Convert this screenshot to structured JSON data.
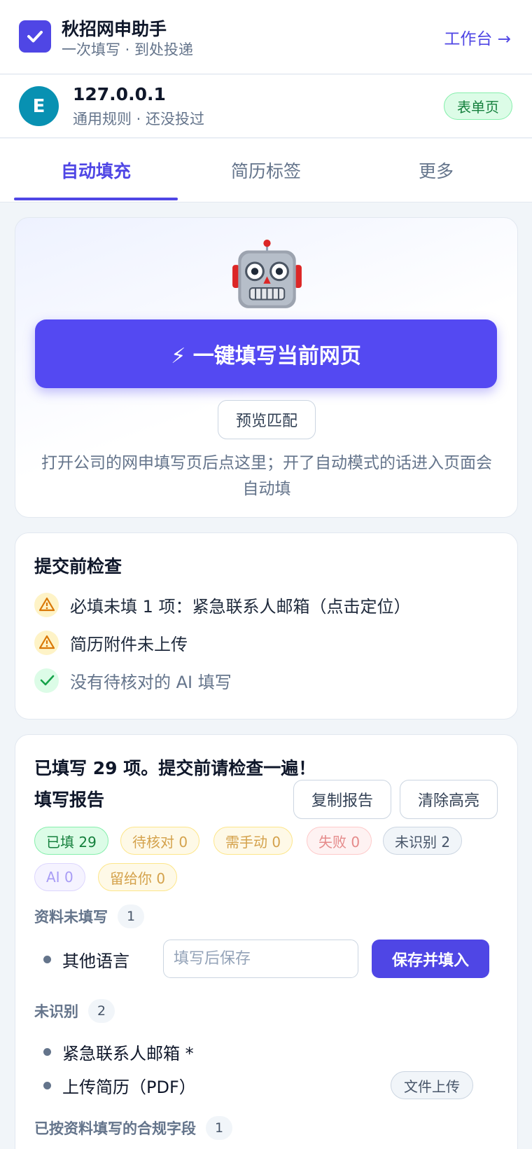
{
  "header": {
    "title": "秋招网申助手",
    "subtitle": "一次填写 · 到处投递",
    "workbench_link": "工作台 →",
    "logo_icon": "checkbox-check-icon",
    "accent_color": "#4f46e5"
  },
  "site": {
    "avatar_letter": "E",
    "host": "127.0.0.1",
    "status": "通用规则 · 还没投过",
    "page_type_badge": "表单页"
  },
  "tabs": [
    {
      "label": "自动填充",
      "active": true
    },
    {
      "label": "简历标签",
      "active": false
    },
    {
      "label": "更多",
      "active": false
    }
  ],
  "hero": {
    "icon": "robot-icon",
    "fill_button": "⚡ 一键填写当前网页",
    "preview_button": "预览匹配",
    "hint": "打开公司的网申填写页后点这里；开了自动模式的话进入页面会自动填"
  },
  "precheck": {
    "title": "提交前检查",
    "items": [
      {
        "icon": "warning-icon",
        "text": "必填未填 1 项：紧急联系人邮箱（点击定位）"
      },
      {
        "icon": "warning-icon",
        "text": "简历附件未上传"
      },
      {
        "icon": "check-icon",
        "text": "没有待核对的 AI 填写"
      }
    ]
  },
  "report": {
    "summary": "已填写 29 项。提交前请检查一遍！",
    "title": "填写报告",
    "copy_button": "复制报告",
    "clear_button": "清除高亮",
    "stats": [
      {
        "label": "已填 29"
      },
      {
        "label": "待核对 0"
      },
      {
        "label": "需手动 0"
      },
      {
        "label": "失败 0"
      },
      {
        "label": "未识别 2"
      },
      {
        "label": "AI 0"
      },
      {
        "label": "留给你 0"
      }
    ],
    "missing_section": {
      "label": "资料未填写",
      "count": "1",
      "items": [
        {
          "name": "其他语言",
          "placeholder": "填写后保存",
          "value": "",
          "button": "保存并填入"
        }
      ]
    },
    "unrecognized_section": {
      "label": "未识别",
      "count": "2",
      "items": [
        {
          "name": "紧急联系人邮箱 *",
          "type": ""
        },
        {
          "name": "上传简历（PDF）",
          "type": "文件上传"
        }
      ]
    },
    "compliance_section": {
      "label": "已按资料填写的合规字段",
      "count": "1"
    }
  }
}
